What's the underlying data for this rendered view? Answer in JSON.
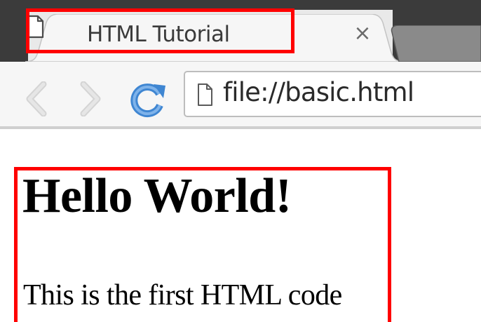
{
  "browser": {
    "tab": {
      "title": "HTML Tutorial",
      "close_glyph": "×",
      "icon": "page-icon"
    },
    "toolbar": {
      "back_icon": "chevron-left-icon",
      "forward_icon": "chevron-right-icon",
      "reload_icon": "reload-icon"
    },
    "omnibox": {
      "url": "file://basic.html",
      "icon": "page-icon"
    }
  },
  "page": {
    "heading": "Hello World!",
    "paragraph": "This is the first HTML code"
  },
  "annotations": {
    "highlight_color": "#ff0000"
  },
  "colors": {
    "window_frame": "#3b3b3b",
    "tab_strip": "#e9e9e9",
    "toolbar": "#f6f6f6",
    "reload_blue": "#4a90d9"
  }
}
